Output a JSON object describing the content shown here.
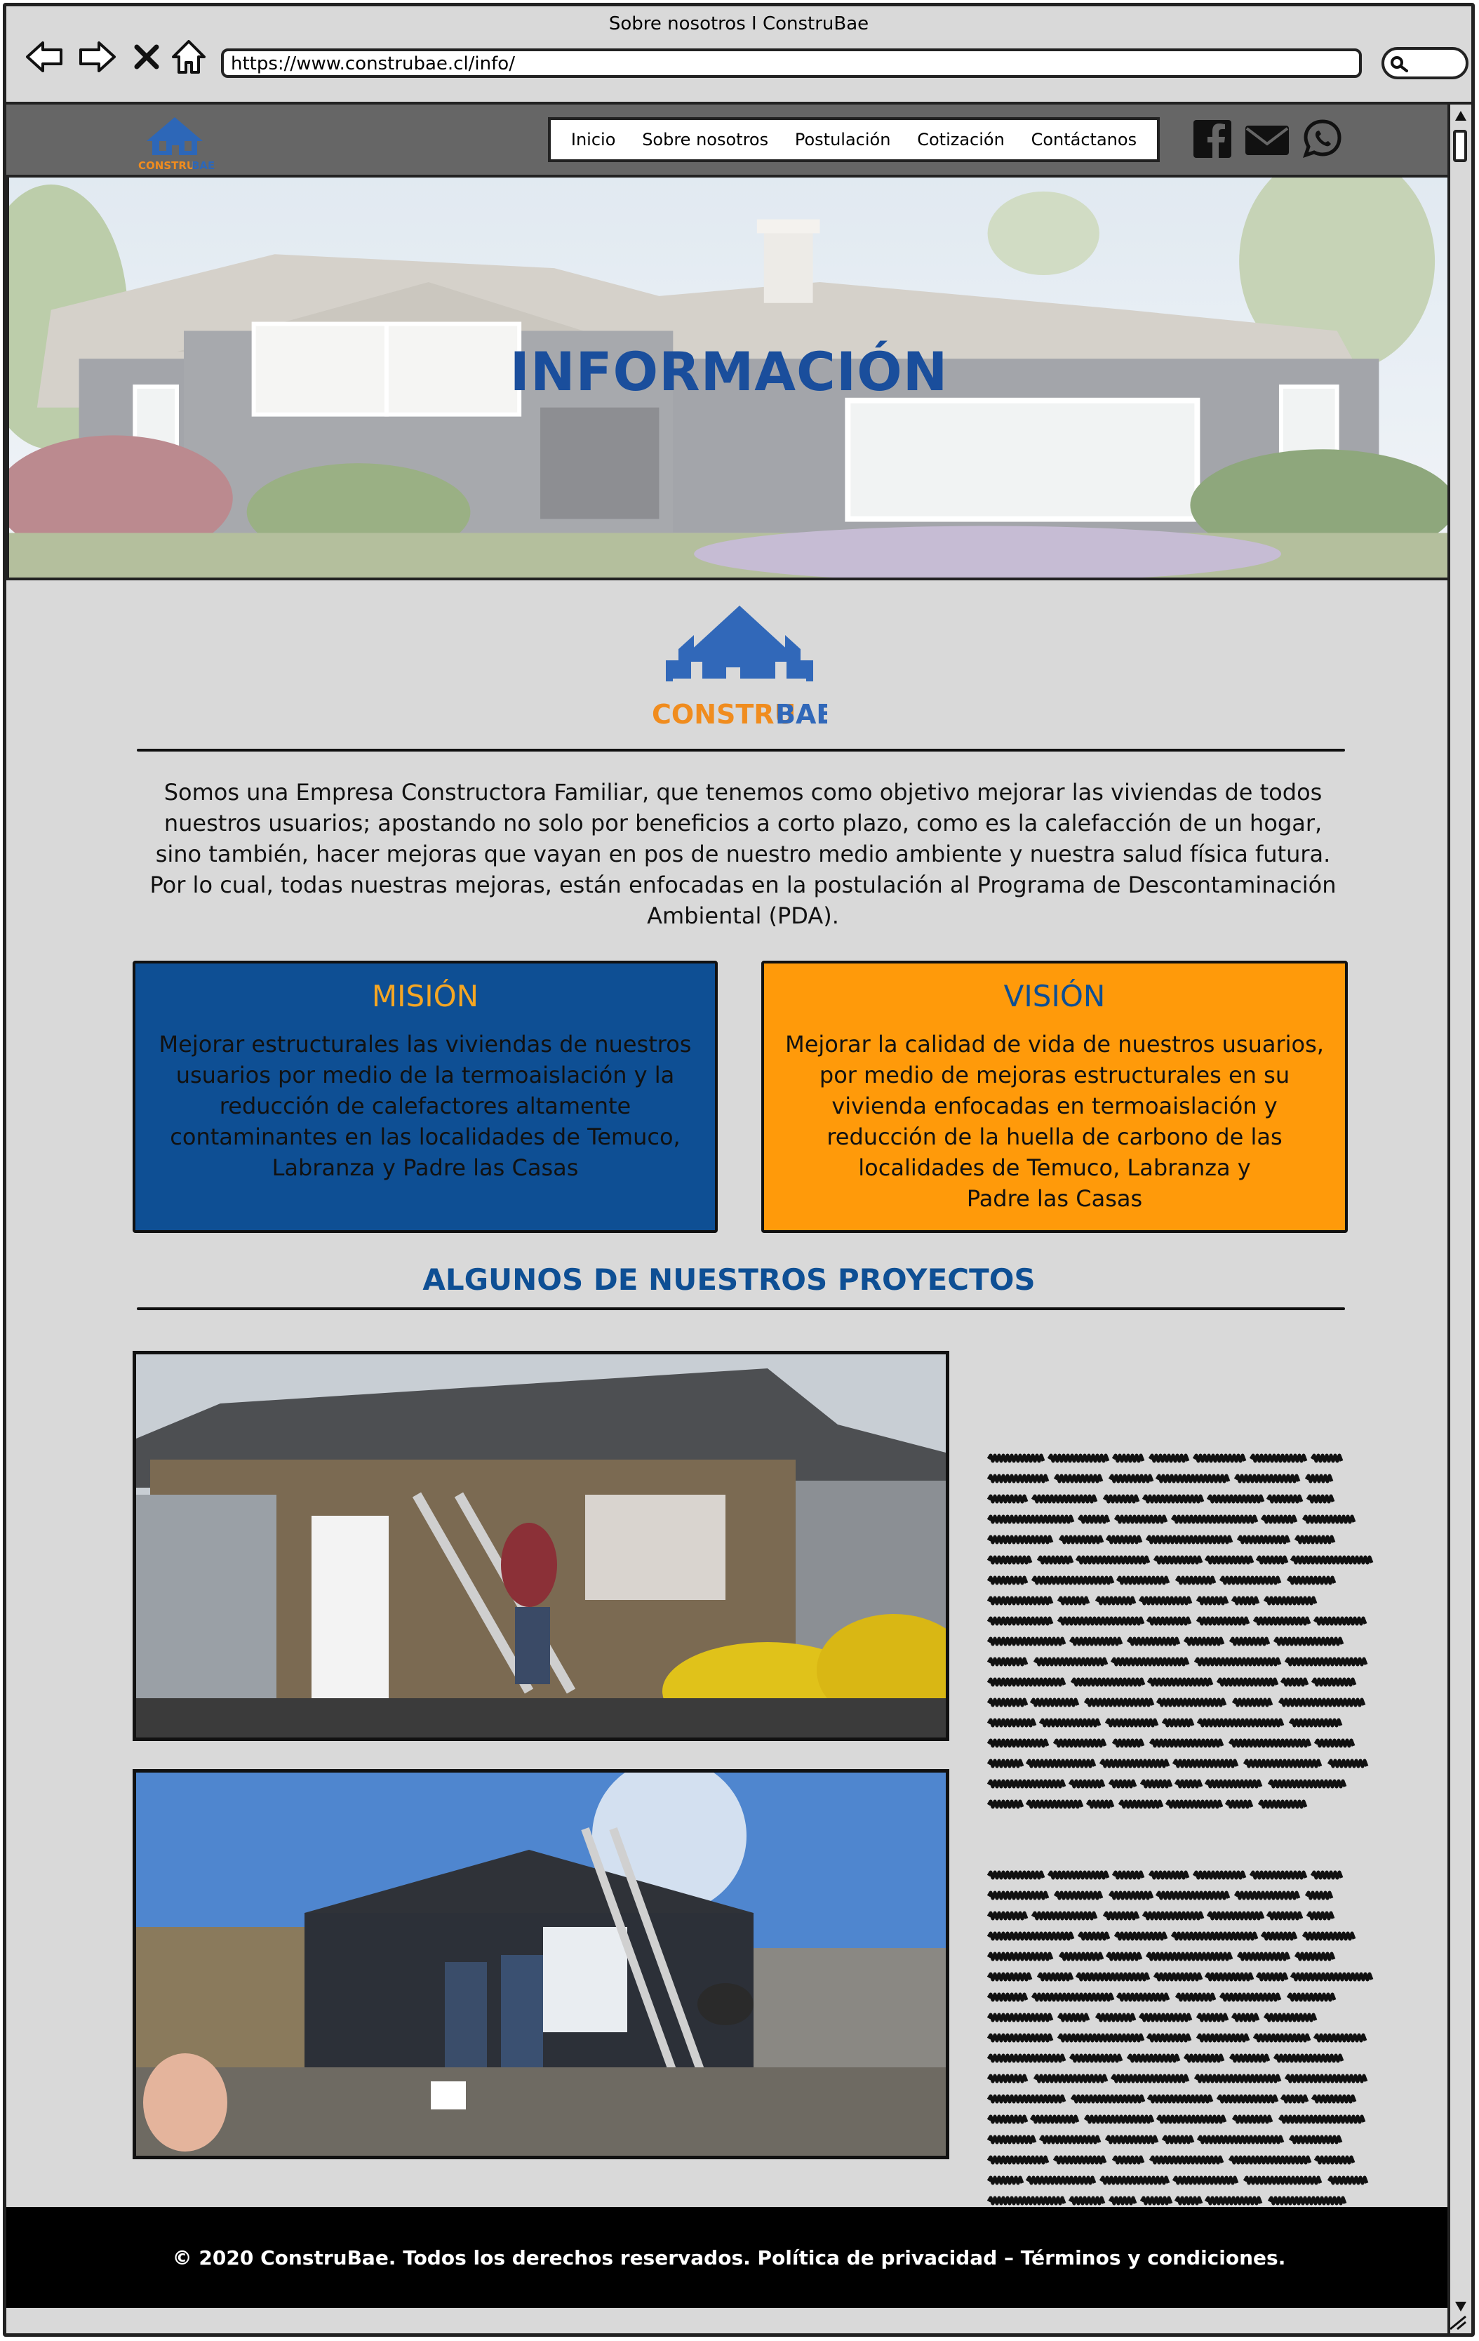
{
  "window": {
    "title": "Sobre nosotros I ConstruBae"
  },
  "address_bar": {
    "url": "https://www.construbae.cl/info/"
  },
  "logo": {
    "construbae_1": "CONSTRU",
    "construbae_2": "BAE"
  },
  "menu": {
    "items": [
      {
        "label": "Inicio"
      },
      {
        "label": "Sobre nosotros"
      },
      {
        "label": "Postulación"
      },
      {
        "label": "Cotización"
      },
      {
        "label": "Contáctanos"
      }
    ]
  },
  "social": [
    "facebook-icon",
    "email-icon",
    "whatsapp-icon"
  ],
  "hero": {
    "title": "INFORMACIÓN"
  },
  "intro": {
    "lines": [
      "Somos una Empresa Constructora Familiar, que tenemos como objetivo mejorar las viviendas de todos",
      "nuestros usuarios; apostando no solo por beneficios a corto plazo, como es la calefacción de un hogar,",
      "sino también, hacer mejoras que vayan en pos de nuestro medio ambiente y nuestra salud física futura.",
      "Por lo cual, todas nuestras mejoras, están enfocadas en la postulación al Programa de Descontaminación",
      "Ambiental (PDA)."
    ]
  },
  "mision": {
    "title": "MISIÓN",
    "lines": [
      "Mejorar estructurales las viviendas de nuestros",
      "usuarios por medio de la termoaislación y la",
      "reducción de calefactores altamente",
      "contaminantes en las localidades de Temuco,",
      "Labranza y Padre las Casas"
    ]
  },
  "vision": {
    "title": "VISIÓN",
    "lines": [
      "Mejorar la calidad de vida de nuestros usuarios,",
      "por medio de mejoras estructurales en su",
      "vivienda enfocadas en termoaislación y",
      "reducción de la huella de carbono de las",
      "localidades de Temuco, Labranza y",
      "Padre las Casas"
    ]
  },
  "projects": {
    "title": "ALGUNOS DE NUESTROS PROYECTOS"
  },
  "footer": {
    "text": "© 2020 ConstruBae. Todos los derechos reservados. Política de privacidad – Términos y condiciones."
  },
  "colors": {
    "brand_blue": "#0e4f94",
    "brand_orange": "#ff9a0a",
    "header_gray": "#666666"
  }
}
